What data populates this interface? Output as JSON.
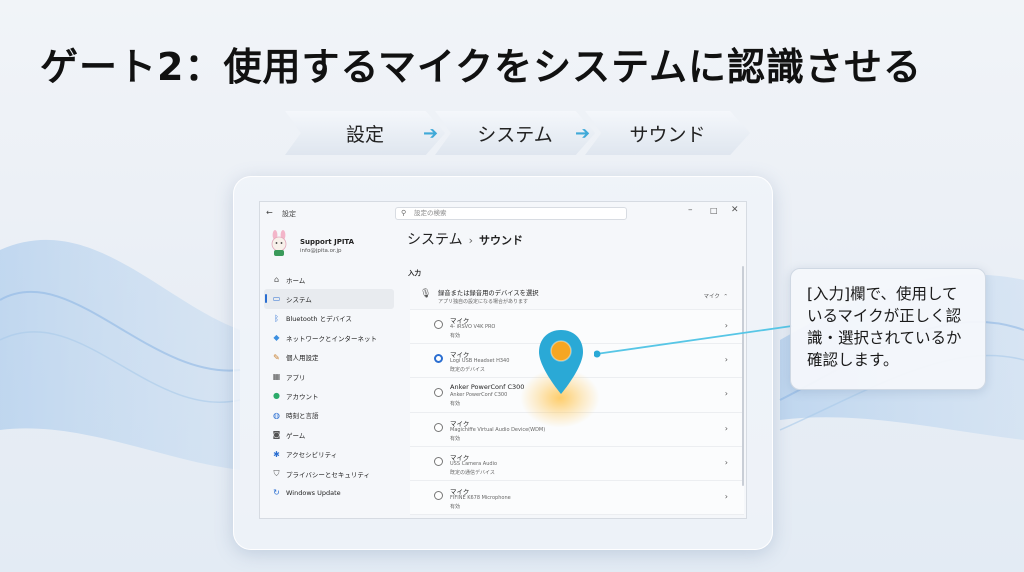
{
  "slide": {
    "title": "ゲート2：使用するマイクをシステムに認識させる",
    "flow": [
      "設定",
      "システム",
      "サウンド"
    ],
    "callout": "[入力]欄で、使用しているマイクが正しく認識・選択されているか確認します。"
  },
  "window": {
    "app_title": "設定",
    "search_placeholder": "設定の検索",
    "user": {
      "name": "Support JPITA",
      "email": "info@jpita.or.jp"
    },
    "nav": [
      {
        "label": "ホーム",
        "icon": "home-icon",
        "glyph": "⌂",
        "color": "#555",
        "active": false
      },
      {
        "label": "システム",
        "icon": "system-icon",
        "glyph": "▭",
        "color": "#2a6ed1",
        "active": true
      },
      {
        "label": "Bluetooth とデバイス",
        "icon": "bluetooth-icon",
        "glyph": "ᛒ",
        "color": "#2a6ed1",
        "active": false
      },
      {
        "label": "ネットワークとインターネット",
        "icon": "network-icon",
        "glyph": "◆",
        "color": "#3c8fe0",
        "active": false
      },
      {
        "label": "個人用設定",
        "icon": "brush-icon",
        "glyph": "✎",
        "color": "#c77d2a",
        "active": false
      },
      {
        "label": "アプリ",
        "icon": "apps-icon",
        "glyph": "▦",
        "color": "#555",
        "active": false
      },
      {
        "label": "アカウント",
        "icon": "account-icon",
        "glyph": "●",
        "color": "#2bab6a",
        "active": false
      },
      {
        "label": "時刻と言語",
        "icon": "globe-icon",
        "glyph": "◍",
        "color": "#2a6ed1",
        "active": false
      },
      {
        "label": "ゲーム",
        "icon": "gamepad-icon",
        "glyph": "◙",
        "color": "#555",
        "active": false
      },
      {
        "label": "アクセシビリティ",
        "icon": "accessibility-icon",
        "glyph": "✱",
        "color": "#2a6ed1",
        "active": false
      },
      {
        "label": "プライバシーとセキュリティ",
        "icon": "shield-icon",
        "glyph": "⛉",
        "color": "#555",
        "active": false
      },
      {
        "label": "Windows Update",
        "icon": "update-icon",
        "glyph": "↻",
        "color": "#2a6ed1",
        "active": false
      }
    ],
    "breadcrumb_parent": "システム",
    "breadcrumb_sep": "›",
    "breadcrumb_current": "サウンド",
    "section_label": "入力",
    "input_header": {
      "title": "録音または録音用のデバイスを選択",
      "subtitle": "アプリ独自の設定になる場合があります",
      "meta": "マイク"
    },
    "devices": [
      {
        "name": "マイク",
        "sub": "4- iRSVO V4K PRO",
        "state": "有効",
        "selected": false
      },
      {
        "name": "マイク",
        "sub": "Logi USB Headset H340",
        "state": "既定のデバイス",
        "selected": true
      },
      {
        "name": "Anker PowerConf C300",
        "sub": "Anker PowerConf C300",
        "state": "有効",
        "selected": false
      },
      {
        "name": "マイク",
        "sub": "Magichiffe Virtual Audio Device(WDM)",
        "state": "有効",
        "selected": false
      },
      {
        "name": "マイク",
        "sub": "USS Camera Audio",
        "state": "既定の通信デバイス",
        "selected": false
      },
      {
        "name": "マイク",
        "sub": "FIFINE K678 Microphone",
        "state": "有効",
        "selected": false
      }
    ]
  },
  "colors": {
    "accent": "#2a6ed1",
    "pin": "#2aa9d6",
    "pin_center": "#f5a623",
    "arrow": "#3fa9d8"
  }
}
